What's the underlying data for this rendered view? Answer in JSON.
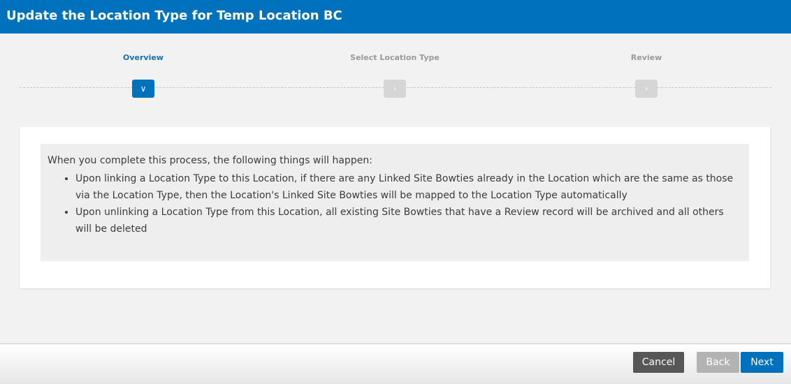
{
  "window": {
    "title": "Update the Location Type for Temp Location BC"
  },
  "stepper": {
    "steps": [
      {
        "label": "Overview",
        "state": "active",
        "icon": "chevron-down-icon",
        "glyph": "∨"
      },
      {
        "label": "Select Location Type",
        "state": "pending",
        "icon": "chevron-right-icon",
        "glyph": "›"
      },
      {
        "label": "Review",
        "state": "pending",
        "icon": "chevron-right-icon",
        "glyph": "›"
      }
    ]
  },
  "overview": {
    "intro": "When you complete this process, the following things will happen:",
    "bullets": [
      "Upon linking a Location Type to this Location, if there are any Linked Site Bowties already in the Location which are the same as those via the Location Type, then the Location's Linked Site Bowties will be mapped to the Location Type automatically",
      "Upon unlinking a Location Type from this Location, all existing Site Bowties that have a Review record will be archived and all others will be deleted"
    ]
  },
  "footer": {
    "cancel_label": "Cancel",
    "back_label": "Back",
    "next_label": "Next"
  },
  "colors": {
    "brand": "#0071bc",
    "cancel": "#575757",
    "disabled": "#b3b3b3",
    "step_inactive": "#d6d6d6"
  }
}
